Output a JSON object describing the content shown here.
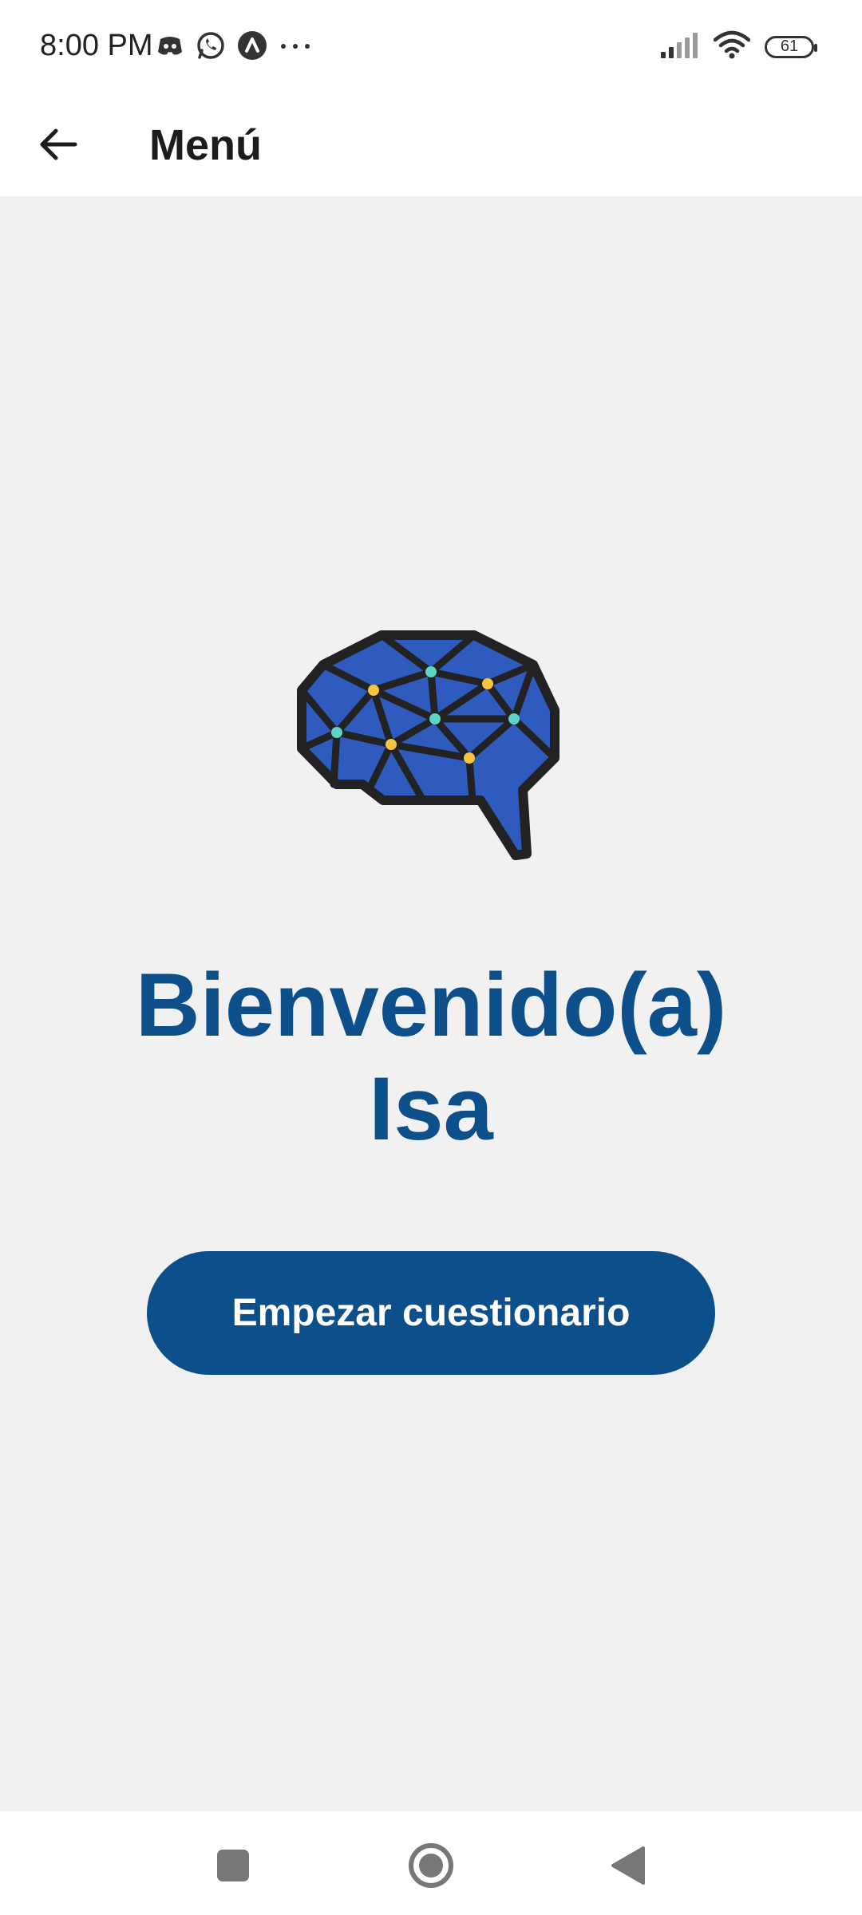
{
  "status_bar": {
    "time": "8:00 PM",
    "battery": "61",
    "icons_left": [
      "discord-icon",
      "whatsapp-icon",
      "app-a-icon",
      "more-dots-icon"
    ],
    "icons_right": [
      "signal-icon",
      "wifi-icon",
      "battery-icon"
    ]
  },
  "app_bar": {
    "title": "Menú",
    "back_icon": "arrow-left-icon"
  },
  "main": {
    "logo_icon": "brain-network-icon",
    "welcome_line1": "Bienvenido(a)",
    "welcome_line2": "Isa",
    "start_button_label": "Empezar cuestionario"
  },
  "nav_bar": {
    "icons": [
      "recents-square-icon",
      "home-circle-icon",
      "back-triangle-icon"
    ]
  },
  "colors": {
    "primary": "#0d4f8b",
    "background": "#f1f1f1",
    "brain_fill": "#2f5bbf",
    "node_yellow": "#f5c542",
    "node_teal": "#5fd3c4"
  }
}
